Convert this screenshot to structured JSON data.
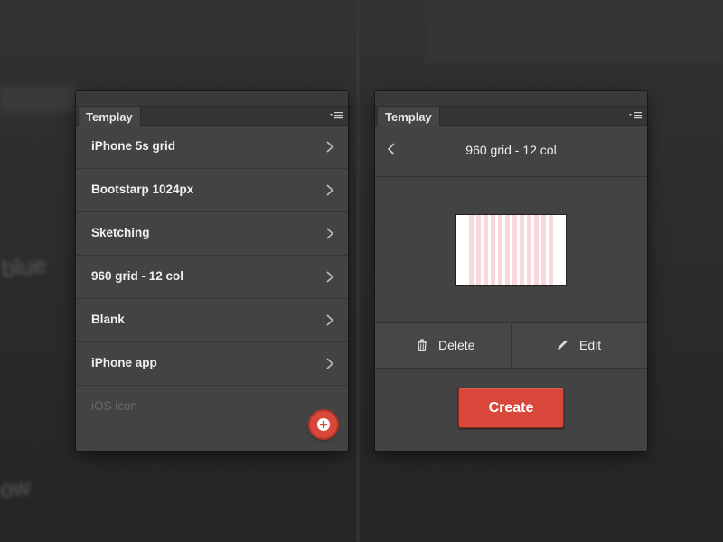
{
  "background": {
    "blurred_text_1": "blue",
    "blurred_text_2": "ow"
  },
  "left_panel": {
    "tab_title": "Templay",
    "items": [
      {
        "label": "iPhone 5s grid"
      },
      {
        "label": "Bootstarp 1024px"
      },
      {
        "label": "Sketching"
      },
      {
        "label": "960 grid - 12 col"
      },
      {
        "label": "Blank"
      },
      {
        "label": "iPhone app"
      },
      {
        "label": "iOS icon"
      }
    ],
    "add_icon": "plus-icon"
  },
  "right_panel": {
    "tab_title": "Templay",
    "detail_title": "960 grid - 12 col",
    "back_icon": "chevron-left-icon",
    "delete_label": "Delete",
    "edit_label": "Edit",
    "create_label": "Create"
  },
  "colors": {
    "accent": "#d9473a",
    "panel_bg": "#434343",
    "grid_column": "#f8d8da"
  }
}
